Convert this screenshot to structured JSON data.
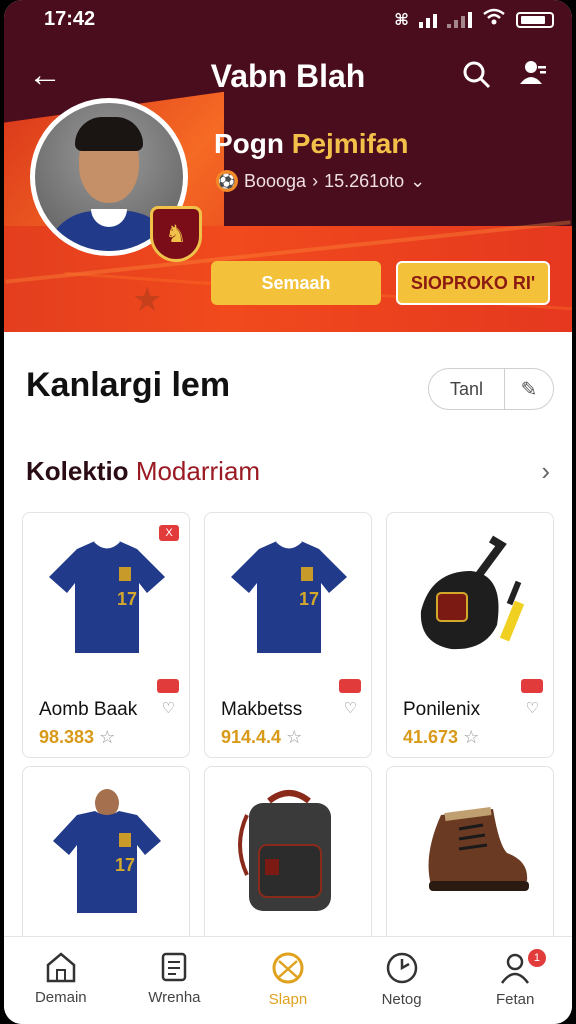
{
  "status": {
    "time": "17:42"
  },
  "header": {
    "title": "Vabn Blah",
    "player_first": "Pogn",
    "player_second": "Pejmifan",
    "meta_club": "Boooga",
    "meta_sep": "›",
    "meta_value": "15.261oto",
    "btn_primary": "Semaah",
    "btn_secondary": "SIOPROKO RI'"
  },
  "section": {
    "title": "Kanlargi lem",
    "seg_label": "Tanl",
    "collection_bold": "Kolektio",
    "collection_rest": "Modarriam"
  },
  "products": [
    {
      "name": "Aomb Baak",
      "price": "98.383",
      "kind": "jersey",
      "top_badge": "X"
    },
    {
      "name": "Makbetss",
      "price": "914.4.4",
      "kind": "jersey",
      "top_badge": ""
    },
    {
      "name": "Ponilenix",
      "price": "41.673",
      "kind": "bag",
      "top_badge": ""
    },
    {
      "name": "",
      "price": "",
      "kind": "jersey-model",
      "top_badge": ""
    },
    {
      "name": "",
      "price": "",
      "kind": "backpack",
      "top_badge": ""
    },
    {
      "name": "",
      "price": "",
      "kind": "boot",
      "top_badge": ""
    }
  ],
  "nav": [
    {
      "label": "Demain",
      "icon": "home-icon"
    },
    {
      "label": "Wrenha",
      "icon": "document-icon"
    },
    {
      "label": "Slapn",
      "icon": "ball-icon",
      "active": true
    },
    {
      "label": "Netog",
      "icon": "clock-icon"
    },
    {
      "label": "Fetan",
      "icon": "profile-icon",
      "badge": "1"
    }
  ],
  "colors": {
    "maroon": "#4a0d1e",
    "orange": "#f14a1d",
    "gold": "#f3c23a",
    "jersey": "#213a8a"
  }
}
